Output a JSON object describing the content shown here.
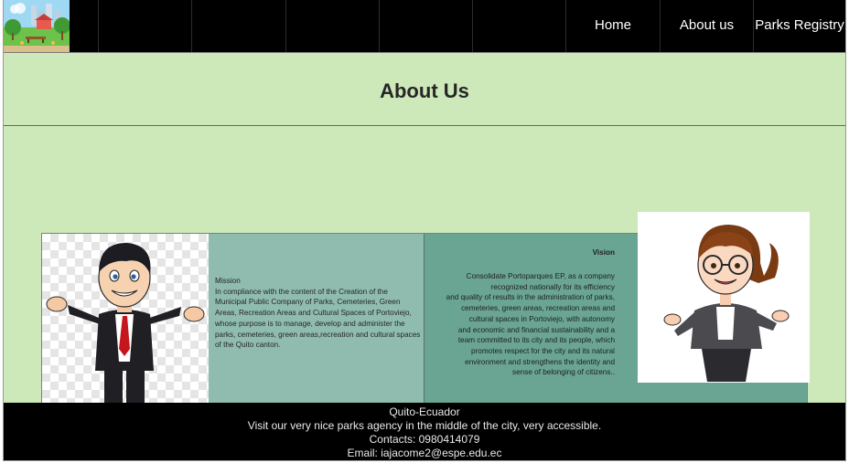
{
  "nav": {
    "logo_label": "parks logo",
    "links": [
      {
        "label": "Home"
      },
      {
        "label": "About us"
      },
      {
        "label": "Parks Registry"
      }
    ]
  },
  "page": {
    "title": "About Us"
  },
  "mission": {
    "title": "Mission",
    "body": "In compliance with the content of the Creation of the Municipal Public Company of Parks, Cemeteries, Green Areas, Recreation Areas and Cultural Spaces of Portoviejo, whose purpose is to  manage, develop and administer the parks, cemeteries, green areas,recreation and cultural spaces of the Quito canton."
  },
  "vision": {
    "title": "Vision",
    "body": "Consolidate Portoparques EP, as a company\nrecognized nationally for its efficiency\nand quality of results in the administration of parks,\ncemeteries, green areas, recreation areas and\ncultural spaces in Portoviejo, with autonomy\nand economic and financial sustainability and a\nteam committed to its city and its people, which\npromotes respect for the city and its natural\nenvironment and strengthens the identity and\nsense of belonging of citizens.."
  },
  "footer": {
    "location": "Quito-Ecuador",
    "tagline": "Visit our very nice parks agency in the middle of the city, very accessible.",
    "contacts": "Contacts: 0980414079",
    "email": "Email: iajacome2@espe.edu.ec"
  },
  "colors": {
    "page_bg": "#cde8b9",
    "nav_bg": "#000000",
    "mission_bg": "#8fbcae",
    "vision_bg": "#6aa593",
    "footer_bg": "#000000"
  }
}
